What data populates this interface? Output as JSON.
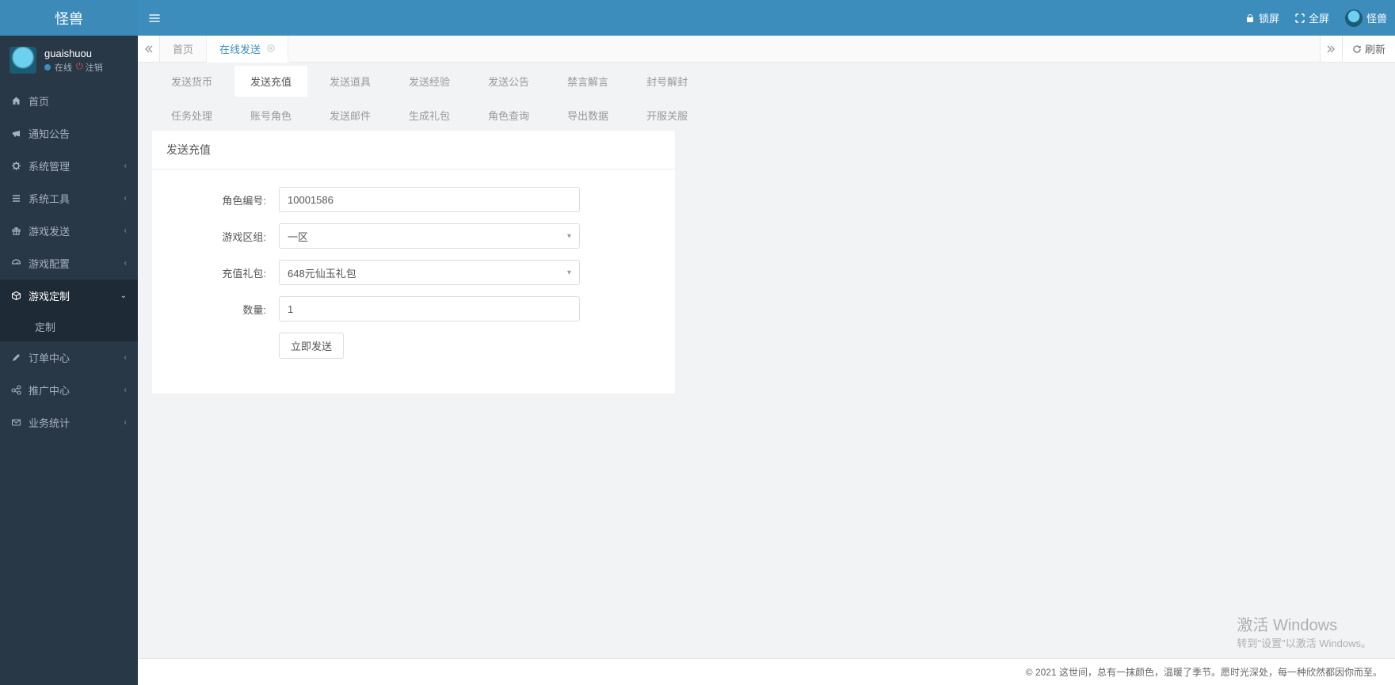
{
  "brand": "怪兽",
  "topbar": {
    "lock": "锁屏",
    "fullscreen": "全屏",
    "username": "怪兽"
  },
  "profile": {
    "username": "guaishuou",
    "online": "在线",
    "logout": "注销"
  },
  "sidebar": [
    {
      "icon": "home",
      "label": "首页",
      "expandable": false
    },
    {
      "icon": "bullhorn",
      "label": "通知公告",
      "expandable": false
    },
    {
      "icon": "gear",
      "label": "系统管理",
      "expandable": true
    },
    {
      "icon": "list",
      "label": "系统工具",
      "expandable": true
    },
    {
      "icon": "gift",
      "label": "游戏发送",
      "expandable": true
    },
    {
      "icon": "dashboard",
      "label": "游戏配置",
      "expandable": true
    },
    {
      "icon": "cube",
      "label": "游戏定制",
      "expandable": true,
      "active": true,
      "open": true,
      "children": [
        {
          "label": "定制"
        }
      ]
    },
    {
      "icon": "pencil",
      "label": "订单中心",
      "expandable": true
    },
    {
      "icon": "share",
      "label": "推广中心",
      "expandable": true
    },
    {
      "icon": "envelope",
      "label": "业务统计",
      "expandable": true
    }
  ],
  "tabs": {
    "home": "首页",
    "items": [
      {
        "label": "在线发送",
        "active": true
      }
    ],
    "refresh": "刷新"
  },
  "subtabs_row1": [
    "发送货币",
    "发送充值",
    "发送道具",
    "发送经验",
    "发送公告",
    "禁言解言",
    "封号解封"
  ],
  "subtabs_row2": [
    "任务处理",
    "账号角色",
    "发送邮件",
    "生成礼包",
    "角色查询",
    "导出数据",
    "开服关服"
  ],
  "subtabs_active_index": 1,
  "panel": {
    "title": "发送充值",
    "fields": {
      "role_id": {
        "label": "角色编号:",
        "value": "10001586"
      },
      "zone": {
        "label": "游戏区组:",
        "value": "一区"
      },
      "pack": {
        "label": "充值礼包:",
        "value": "648元仙玉礼包"
      },
      "qty": {
        "label": "数量:",
        "value": "1"
      }
    },
    "submit": "立即发送"
  },
  "footer": "© 2021 这世间，总有一抹颜色，温暖了季节。愿时光深处，每一种欣然都因你而至。",
  "watermark": {
    "l1": "激活 Windows",
    "l2": "转到\"设置\"以激活 Windows。"
  }
}
